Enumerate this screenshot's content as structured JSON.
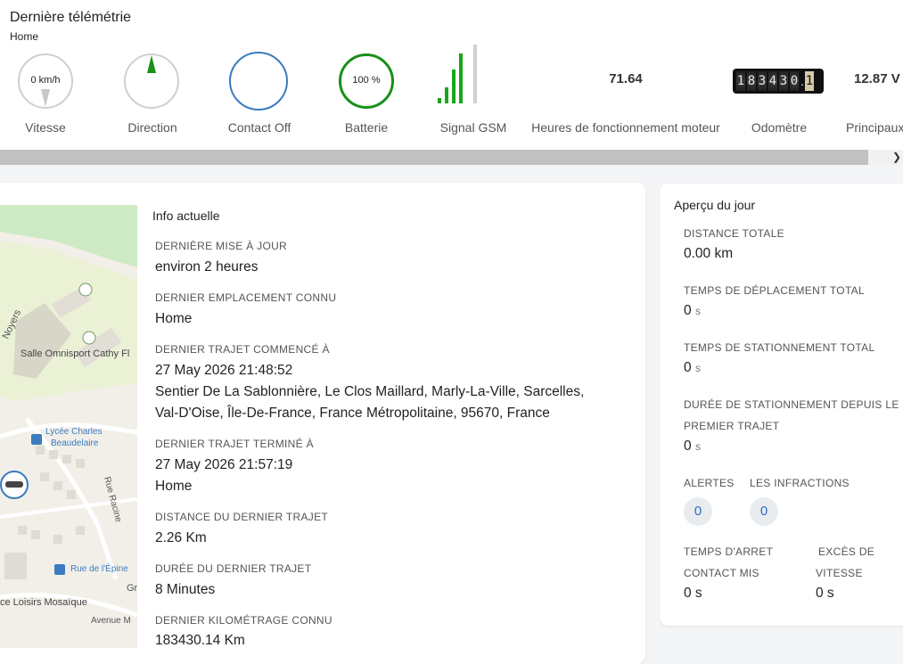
{
  "header": {
    "title": "Dernière télémétrie",
    "subtitle": "Home"
  },
  "gauges": {
    "speed": {
      "value": "0 km/h",
      "label": "Vitesse"
    },
    "direction": {
      "label": "Direction"
    },
    "ignition": {
      "label": "Contact Off"
    },
    "battery": {
      "value": "100 %",
      "label": "Batterie",
      "level": 1.0
    },
    "gsm": {
      "label": "Signal GSM",
      "bars_lit": 4,
      "bars_total": 5
    },
    "engine_hours": {
      "value": "71.64",
      "label": "Heures de fonctionnement moteur"
    },
    "odometer": {
      "digits": [
        "1",
        "8",
        "3",
        "4",
        "3",
        "0",
        "1"
      ],
      "label": "Odomètre"
    },
    "voltage": {
      "value": "12.87 V",
      "label": "Principaux"
    }
  },
  "map": {
    "labels": {
      "street1": "Noyers",
      "sports": "Salle Omnisport Cathy Fl",
      "school1": "Lycée Charles",
      "school2": "Beaudelaire",
      "street2": "Rue Racine",
      "bus": "Rue de l'Épine",
      "leisure": "ce Loisirs Mosaïque",
      "avenue": "Avenue M",
      "gr": "Gr"
    }
  },
  "info": {
    "title": "Info actuelle",
    "fields": [
      {
        "label": "DERNIÈRE MISE À JOUR",
        "value": "environ 2 heures"
      },
      {
        "label": "DERNIER EMPLACEMENT CONNU",
        "value": "Home"
      },
      {
        "label": "DERNIER TRAJET COMMENCÉ À",
        "value": "27 May 2026 21:48:52",
        "value2": "Sentier De La Sablonnière, Le Clos Maillard, Marly-La-Ville, Sarcelles,",
        "value3": "Val-D'Oise, Île-De-France, France Métropolitaine, 95670, France"
      },
      {
        "label": "DERNIER TRAJET TERMINÉ À",
        "value": "27 May 2026 21:57:19",
        "value2": "Home"
      },
      {
        "label": "DISTANCE DU DERNIER TRAJET",
        "value": "2.26 Km"
      },
      {
        "label": "DURÉE DU DERNIER TRAJET",
        "value": "8 Minutes"
      },
      {
        "label": "DERNIER KILOMÉTRAGE CONNU",
        "value": "183430.14 Km"
      }
    ]
  },
  "apercu": {
    "title": "Aperçu du jour",
    "distance_label": "DISTANCE TOTALE",
    "distance_value": "0.00 km",
    "travel_label": "TEMPS DE DÉPLACEMENT TOTAL",
    "travel_value": "0",
    "travel_unit": "s",
    "parking_label": "TEMPS DE STATIONNEMENT TOTAL",
    "parking_value": "0",
    "parking_unit": "s",
    "parking_since_label1": "DURÉE DE STATIONNEMENT DEPUIS LE",
    "parking_since_label2": "PREMIER TRAJET",
    "parking_since_value": "0",
    "parking_since_unit": "s",
    "alerts_label": "ALERTES",
    "alerts_value": "0",
    "infractions_label": "LES INFRACTIONS",
    "infractions_value": "0",
    "idle_label1": "TEMPS D'ARRET",
    "idle_label2": "CONTACT MIS",
    "idle_value": "0 s",
    "overspeed_label1": "EXCÈS DE",
    "overspeed_label2": "VITESSE",
    "overspeed_value": "0 s"
  },
  "colors": {
    "accent": "#3b7bbf",
    "battery": "#1a8f1a",
    "gsm": "#1aa51a",
    "pill_text": "#2a6fc4"
  }
}
